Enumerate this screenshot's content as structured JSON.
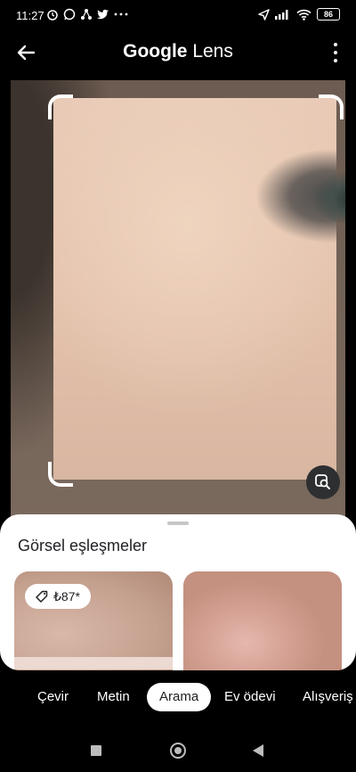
{
  "status_bar": {
    "time": "11:27",
    "notification_icons": [
      "alarm-icon",
      "whatsapp-icon",
      "network-icon",
      "twitter-icon",
      "more-dots-icon"
    ],
    "battery": "86"
  },
  "app_bar": {
    "title_brand": "Google",
    "title_product": "Lens"
  },
  "results": {
    "section_title": "Görsel eşleşmeler",
    "items": [
      {
        "price": "₺87*"
      },
      {
        "price": ""
      }
    ]
  },
  "tabs": [
    {
      "label": "Çevir",
      "active": false
    },
    {
      "label": "Metin",
      "active": false
    },
    {
      "label": "Arama",
      "active": true
    },
    {
      "label": "Ev ödevi",
      "active": false
    },
    {
      "label": "Alışveriş",
      "active": false
    }
  ],
  "colors": {
    "background": "#000000",
    "sheet": "#ffffff",
    "text_dark": "#202124"
  }
}
